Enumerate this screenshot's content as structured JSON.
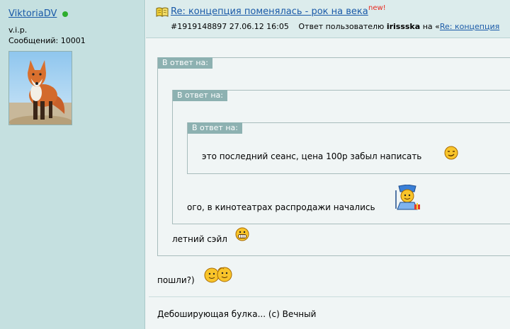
{
  "user": {
    "name": "ViktoriaDV",
    "rank": "v.i.p.",
    "posts_label": "Сообщений: 10001"
  },
  "post": {
    "title": "Re: концепция поменялась - рок на века",
    "new_badge": "new!",
    "id": "#1919148897",
    "datetime": "27.06.12 16:05",
    "reply_prefix": "Ответ пользователю",
    "reply_user": "irissska",
    "reply_on": "на «",
    "reply_link": "Re: концепция",
    "quote_label": "В ответ на:",
    "quote3_text": "это последний сеанс, цена 100р забыл написать",
    "quote2_text": "ого, в кинотеатрах распродажи начались",
    "quote1_text": "летний сэйл",
    "body_text": "пошли?)",
    "signature": "Дебоширующая булка... (с) Вечный"
  },
  "icons": {
    "book": "book-icon",
    "online": "online-status-icon",
    "smile1": "smirk-smiley-icon",
    "smile2": "snow-maiden-smiley-icon",
    "smile3": "grin-smiley-icon",
    "smile4": "two-smileys-icon"
  },
  "colors": {
    "link": "#1a5aa8",
    "new": "#e8281e",
    "sidebar": "#c5e0e0",
    "quote_label_bg": "#8db1b1"
  }
}
